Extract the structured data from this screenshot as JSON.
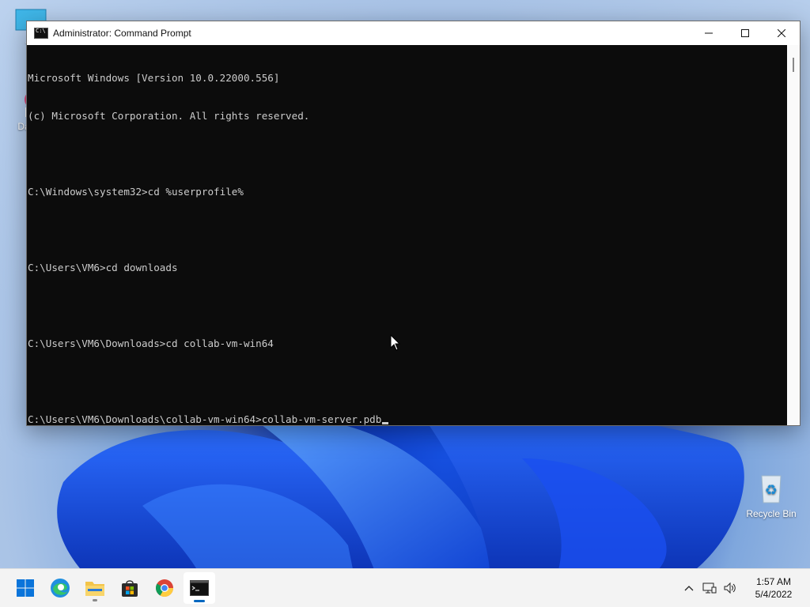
{
  "desktop": {
    "icons": [
      {
        "label": "Th",
        "icon": "this-pc-icon"
      },
      {
        "label": "DataV",
        "icon": "datav-shortcut-icon"
      },
      {
        "label": "Recycle Bin",
        "icon": "recycle-bin-icon"
      }
    ]
  },
  "window": {
    "title": "Administrator: Command Prompt",
    "controls": {
      "minimize": "minimize",
      "maximize": "maximize",
      "close": "close"
    },
    "console_lines": [
      "Microsoft Windows [Version 10.0.22000.556]",
      "(c) Microsoft Corporation. All rights reserved.",
      "",
      "C:\\Windows\\system32>cd %userprofile%",
      "",
      "C:\\Users\\VM6>cd downloads",
      "",
      "C:\\Users\\VM6\\Downloads>cd collab-vm-win64",
      "",
      "C:\\Users\\VM6\\Downloads\\collab-vm-win64>collab-vm-server.pdb"
    ]
  },
  "taskbar": {
    "apps": [
      {
        "name": "start",
        "icon": "windows-start-icon"
      },
      {
        "name": "edge",
        "icon": "edge-icon"
      },
      {
        "name": "file-explorer",
        "icon": "folder-icon"
      },
      {
        "name": "store",
        "icon": "store-icon"
      },
      {
        "name": "chrome",
        "icon": "chrome-icon"
      },
      {
        "name": "command-prompt",
        "icon": "cmd-icon"
      }
    ],
    "tray": {
      "chevron": "chevron-up-icon",
      "network": "network-icon",
      "volume": "volume-icon"
    },
    "clock": {
      "time": "1:57 AM",
      "date": "5/4/2022"
    }
  },
  "colors": {
    "console_bg": "#0c0c0c",
    "console_fg": "#cccccc",
    "accent": "#0067c0"
  }
}
